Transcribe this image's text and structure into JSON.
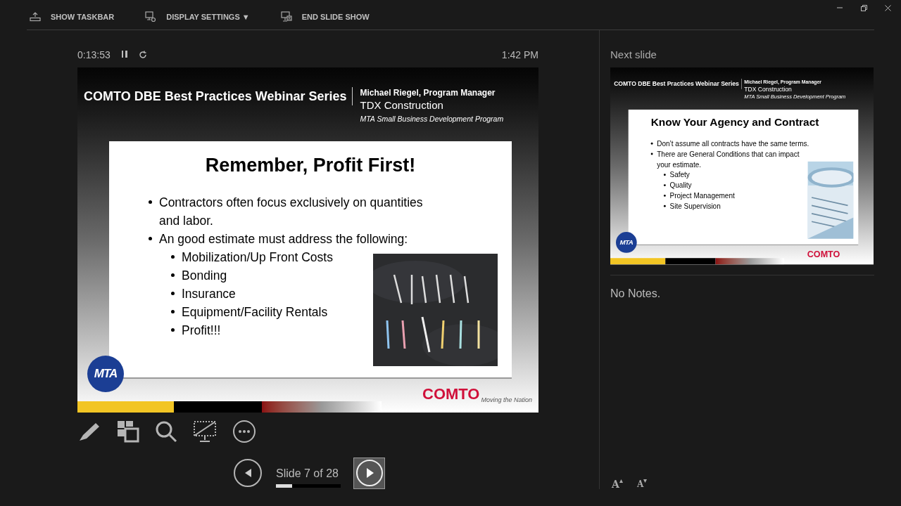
{
  "toolbar": [
    {
      "label": "SHOW TASKBAR",
      "kind": "taskbar"
    },
    {
      "label": "DISPLAY SETTINGS ▼",
      "kind": "display"
    },
    {
      "label": "END SLIDE SHOW",
      "kind": "end"
    }
  ],
  "timer": {
    "elapsed": "0:13:53",
    "clock": "1:42 PM"
  },
  "current_slide": {
    "header": {
      "series": "COMTO DBE Best Practices Webinar Series",
      "presenter": "Michael Riegel, Program Manager",
      "company": "TDX Construction",
      "program": "MTA Small Business Development Program"
    },
    "title": "Remember, Profit First!",
    "bullets": [
      {
        "text": "Contractors often focus exclusively on quantities and labor."
      },
      {
        "text": "An good estimate must address the following:",
        "children": [
          {
            "text": "Mobilization/Up Front Costs"
          },
          {
            "text": "Bonding"
          },
          {
            "text": "Insurance"
          },
          {
            "text": "Equipment/Facility Rentals"
          },
          {
            "text": "Profit!!!"
          }
        ]
      }
    ],
    "logos": {
      "mta": "MTA",
      "comto": "COMTO",
      "tagline": "Moving the Nation"
    }
  },
  "next_slide": {
    "label": "Next slide",
    "header": {
      "series": "COMTO DBE Best Practices Webinar Series",
      "presenter": "Michael Riegel, Program Manager",
      "company": "TDX Construction",
      "program": "MTA Small Business Development Program"
    },
    "title": "Know Your Agency and Contract",
    "bullets": [
      {
        "text": "Don’t assume all contracts have the same terms."
      },
      {
        "text": "There are General Conditions that can impact your estimate.",
        "children": [
          {
            "text": "Safety"
          },
          {
            "text": "Quality"
          },
          {
            "text": "Project Management"
          },
          {
            "text": "Site Supervision"
          }
        ]
      }
    ],
    "logos": {
      "mta": "MTA",
      "comto": "COMTO"
    }
  },
  "notes": "No Notes.",
  "navigation": {
    "counter": "Slide 7 of 28",
    "level": 0.25
  },
  "font_buttons": [
    {
      "label": "A",
      "kind": "increase"
    },
    {
      "label": "A",
      "kind": "decrease"
    }
  ]
}
